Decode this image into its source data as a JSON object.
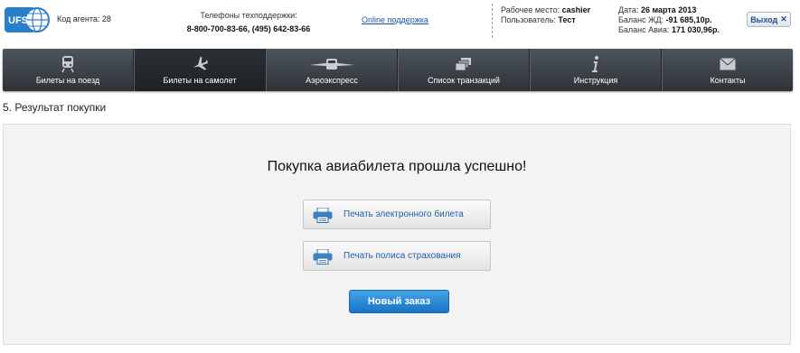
{
  "header": {
    "logo_text": "UFS",
    "agent_label": "Код агента: 28",
    "support_label": "Телефоны техподдержки:",
    "support_phones": "8-800-700-83-66, (495) 642-83-66",
    "online_support": "Online поддержка",
    "workplace_label": "Рабочее место:",
    "workplace_value": "cashier",
    "user_label": "Пользователь:",
    "user_value": "Тест",
    "date_label": "Дата:",
    "date_value": "26 марта 2013",
    "balance_rail_label": "Баланс ЖД:",
    "balance_rail_value": "-91 685,10р.",
    "balance_avia_label": "Баланс Авиа:",
    "balance_avia_value": "171 030,96р.",
    "exit_label": "Выход"
  },
  "nav": {
    "items": [
      {
        "label": "Билеты на поезд",
        "icon": "train-icon"
      },
      {
        "label": "Билеты на самолет",
        "icon": "plane-icon",
        "active": true
      },
      {
        "label": "Аэроэкспресс",
        "icon": "aeroexpress-icon"
      },
      {
        "label": "Список транзакций",
        "icon": "transactions-icon"
      },
      {
        "label": "Инструкция",
        "icon": "info-icon"
      },
      {
        "label": "Контакты",
        "icon": "envelope-icon"
      }
    ]
  },
  "main": {
    "page_title": "5. Результат покупки",
    "success_message": "Покупка авиабилета прошла успешно!",
    "print_ticket_label": "Печать электронного билета",
    "print_insurance_label": "Печать полиса страхования",
    "new_order_label": "Новый заказ"
  },
  "colors": {
    "nav_bg": "#3a4046",
    "link_blue": "#1a55b5",
    "button_blue": "#2a8ad6",
    "logo_blue": "#2a7fc9"
  }
}
